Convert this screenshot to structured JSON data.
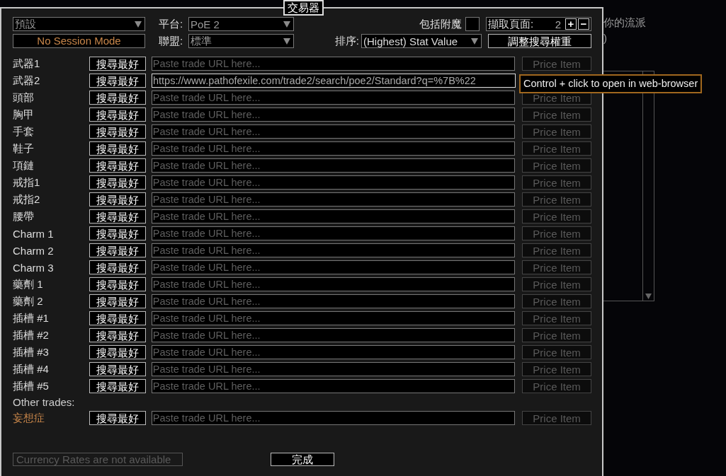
{
  "background": {
    "heading": "你的流派",
    "fragment": ")"
  },
  "window": {
    "title": "交易器"
  },
  "controls": {
    "preset": {
      "value": "預設"
    },
    "session_mode": "No Session Mode",
    "platform": {
      "label": "平台:",
      "value": "PoE 2"
    },
    "league": {
      "label": "聯盟:",
      "value": "標準"
    },
    "include_enchants": {
      "label": "包括附魔",
      "checked": false
    },
    "fetch_pages": {
      "label": "擷取頁面:",
      "value": "2",
      "plus": "+",
      "minus": "−"
    },
    "sort": {
      "label": "排序:",
      "value": "(Highest) Stat Value"
    },
    "adjust_weights": "調整搜尋權重"
  },
  "slots": [
    {
      "label": "武器1",
      "search_button": "搜尋最好",
      "placeholder": "Paste trade URL here...",
      "price_button": "Price Item",
      "price_disabled": true
    },
    {
      "label": "武器2",
      "search_button": "搜尋最好",
      "url": "https://www.pathofexile.com/trade2/search/poe2/Standard?q=%7B%22",
      "focused": true
    },
    {
      "label": "頭部",
      "search_button": "搜尋最好",
      "placeholder": "Paste trade URL here...",
      "price_button": "Price Item",
      "price_disabled": true
    },
    {
      "label": "胸甲",
      "search_button": "搜尋最好",
      "placeholder": "Paste trade URL here...",
      "price_button": "Price Item",
      "price_disabled": true
    },
    {
      "label": "手套",
      "search_button": "搜尋最好",
      "placeholder": "Paste trade URL here...",
      "price_button": "Price Item",
      "price_disabled": true
    },
    {
      "label": "鞋子",
      "search_button": "搜尋最好",
      "placeholder": "Paste trade URL here...",
      "price_button": "Price Item",
      "price_disabled": true
    },
    {
      "label": "項鏈",
      "search_button": "搜尋最好",
      "placeholder": "Paste trade URL here...",
      "price_button": "Price Item",
      "price_disabled": true
    },
    {
      "label": "戒指1",
      "search_button": "搜尋最好",
      "placeholder": "Paste trade URL here...",
      "price_button": "Price Item",
      "price_disabled": true
    },
    {
      "label": "戒指2",
      "search_button": "搜尋最好",
      "placeholder": "Paste trade URL here...",
      "price_button": "Price Item",
      "price_disabled": true
    },
    {
      "label": "腰帶",
      "search_button": "搜尋最好",
      "placeholder": "Paste trade URL here...",
      "price_button": "Price Item",
      "price_disabled": true
    },
    {
      "label": "Charm 1",
      "search_button": "搜尋最好",
      "placeholder": "Paste trade URL here...",
      "price_button": "Price Item",
      "price_disabled": true
    },
    {
      "label": "Charm 2",
      "search_button": "搜尋最好",
      "placeholder": "Paste trade URL here...",
      "price_button": "Price Item",
      "price_disabled": true
    },
    {
      "label": "Charm 3",
      "search_button": "搜尋最好",
      "placeholder": "Paste trade URL here...",
      "price_button": "Price Item",
      "price_disabled": true
    },
    {
      "label": "藥劑 1",
      "search_button": "搜尋最好",
      "placeholder": "Paste trade URL here...",
      "price_button": "Price Item",
      "price_disabled": true
    },
    {
      "label": "藥劑 2",
      "search_button": "搜尋最好",
      "placeholder": "Paste trade URL here...",
      "price_button": "Price Item",
      "price_disabled": true
    },
    {
      "label": "插槽 #1",
      "search_button": "搜尋最好",
      "placeholder": "Paste trade URL here...",
      "price_button": "Price Item",
      "price_disabled": true
    },
    {
      "label": "插槽 #2",
      "search_button": "搜尋最好",
      "placeholder": "Paste trade URL here...",
      "price_button": "Price Item",
      "price_disabled": true
    },
    {
      "label": "插槽 #3",
      "search_button": "搜尋最好",
      "placeholder": "Paste trade URL here...",
      "price_button": "Price Item",
      "price_disabled": true
    },
    {
      "label": "插槽 #4",
      "search_button": "搜尋最好",
      "placeholder": "Paste trade URL here...",
      "price_button": "Price Item",
      "price_disabled": true
    },
    {
      "label": "插槽 #5",
      "search_button": "搜尋最好",
      "placeholder": "Paste trade URL here...",
      "price_button": "Price Item",
      "price_disabled": true
    }
  ],
  "other_trades": {
    "label": "Other trades:",
    "slots": [
      {
        "label": "妄想症",
        "search_button": "搜尋最好",
        "placeholder": "Paste trade URL here...",
        "price_button": "Price Item",
        "price_disabled": true
      }
    ]
  },
  "currency_status": "Currency Rates are not available",
  "done_button": "完成",
  "tooltip": "Control + click to open in web-browser"
}
